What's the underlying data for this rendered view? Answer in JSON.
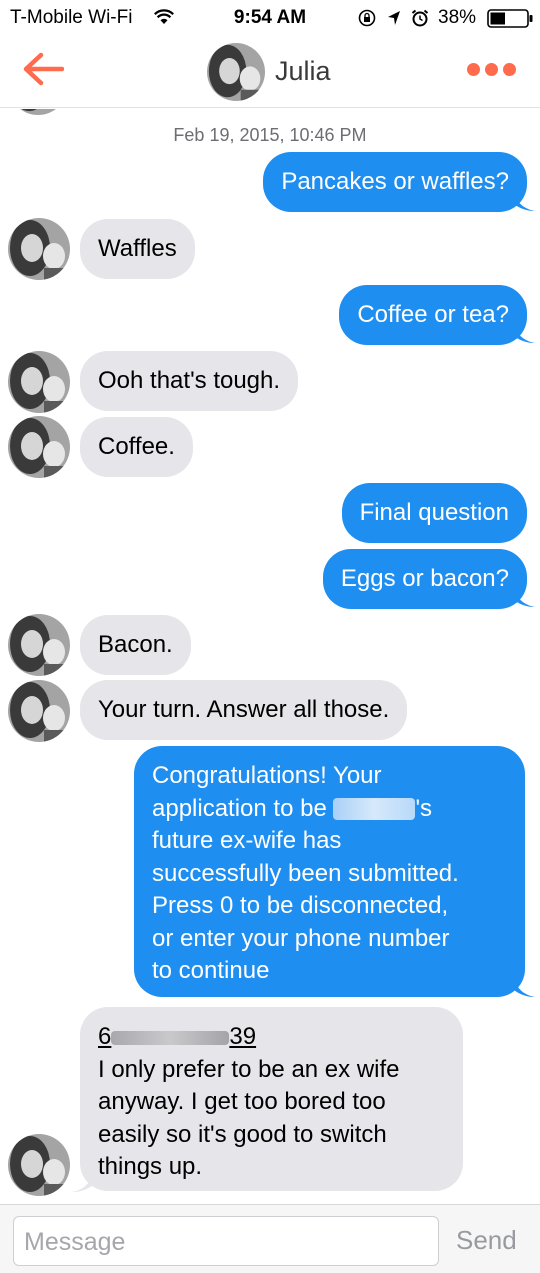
{
  "status_bar": {
    "carrier": "T-Mobile Wi-Fi",
    "time": "9:54 AM",
    "battery_percent": "38%",
    "icons": [
      "wifi-icon",
      "rotation-lock-icon",
      "location-arrow-icon",
      "alarm-icon",
      "battery-icon"
    ]
  },
  "header": {
    "contact_name": "Julia",
    "accent_color": "#ff6b4d"
  },
  "conversation": {
    "timestamp": "Feb 19, 2015, 10:46 PM",
    "messages": [
      {
        "direction": "out",
        "text": "Pancakes or waffles?"
      },
      {
        "direction": "in",
        "text": "Waffles"
      },
      {
        "direction": "out",
        "text": "Coffee or tea?"
      },
      {
        "direction": "in",
        "text": "Ooh that's tough."
      },
      {
        "direction": "in",
        "text": "Coffee."
      },
      {
        "direction": "out",
        "text": "Final question"
      },
      {
        "direction": "out",
        "text": "Eggs or bacon?"
      },
      {
        "direction": "in",
        "text": "Bacon."
      },
      {
        "direction": "in",
        "text": "Your turn. Answer all those."
      },
      {
        "direction": "out",
        "lines": [
          "Congratulations! Your",
          "application to be",
          "'s",
          "future ex-wife has",
          "successfully been submitted.",
          "Press 0 to be disconnected,",
          "or enter your phone number",
          "to continue"
        ]
      },
      {
        "direction": "in",
        "phone_start": "6",
        "phone_end": "39",
        "lines": [
          "I only prefer to be an ex wife",
          "anyway. I get too bored too",
          "easily so it's good to switch",
          "things up."
        ]
      }
    ],
    "outgoing_color": "#1f8ef1",
    "incoming_color": "#e5e5ea"
  },
  "input": {
    "placeholder": "Message",
    "send_label": "Send"
  }
}
